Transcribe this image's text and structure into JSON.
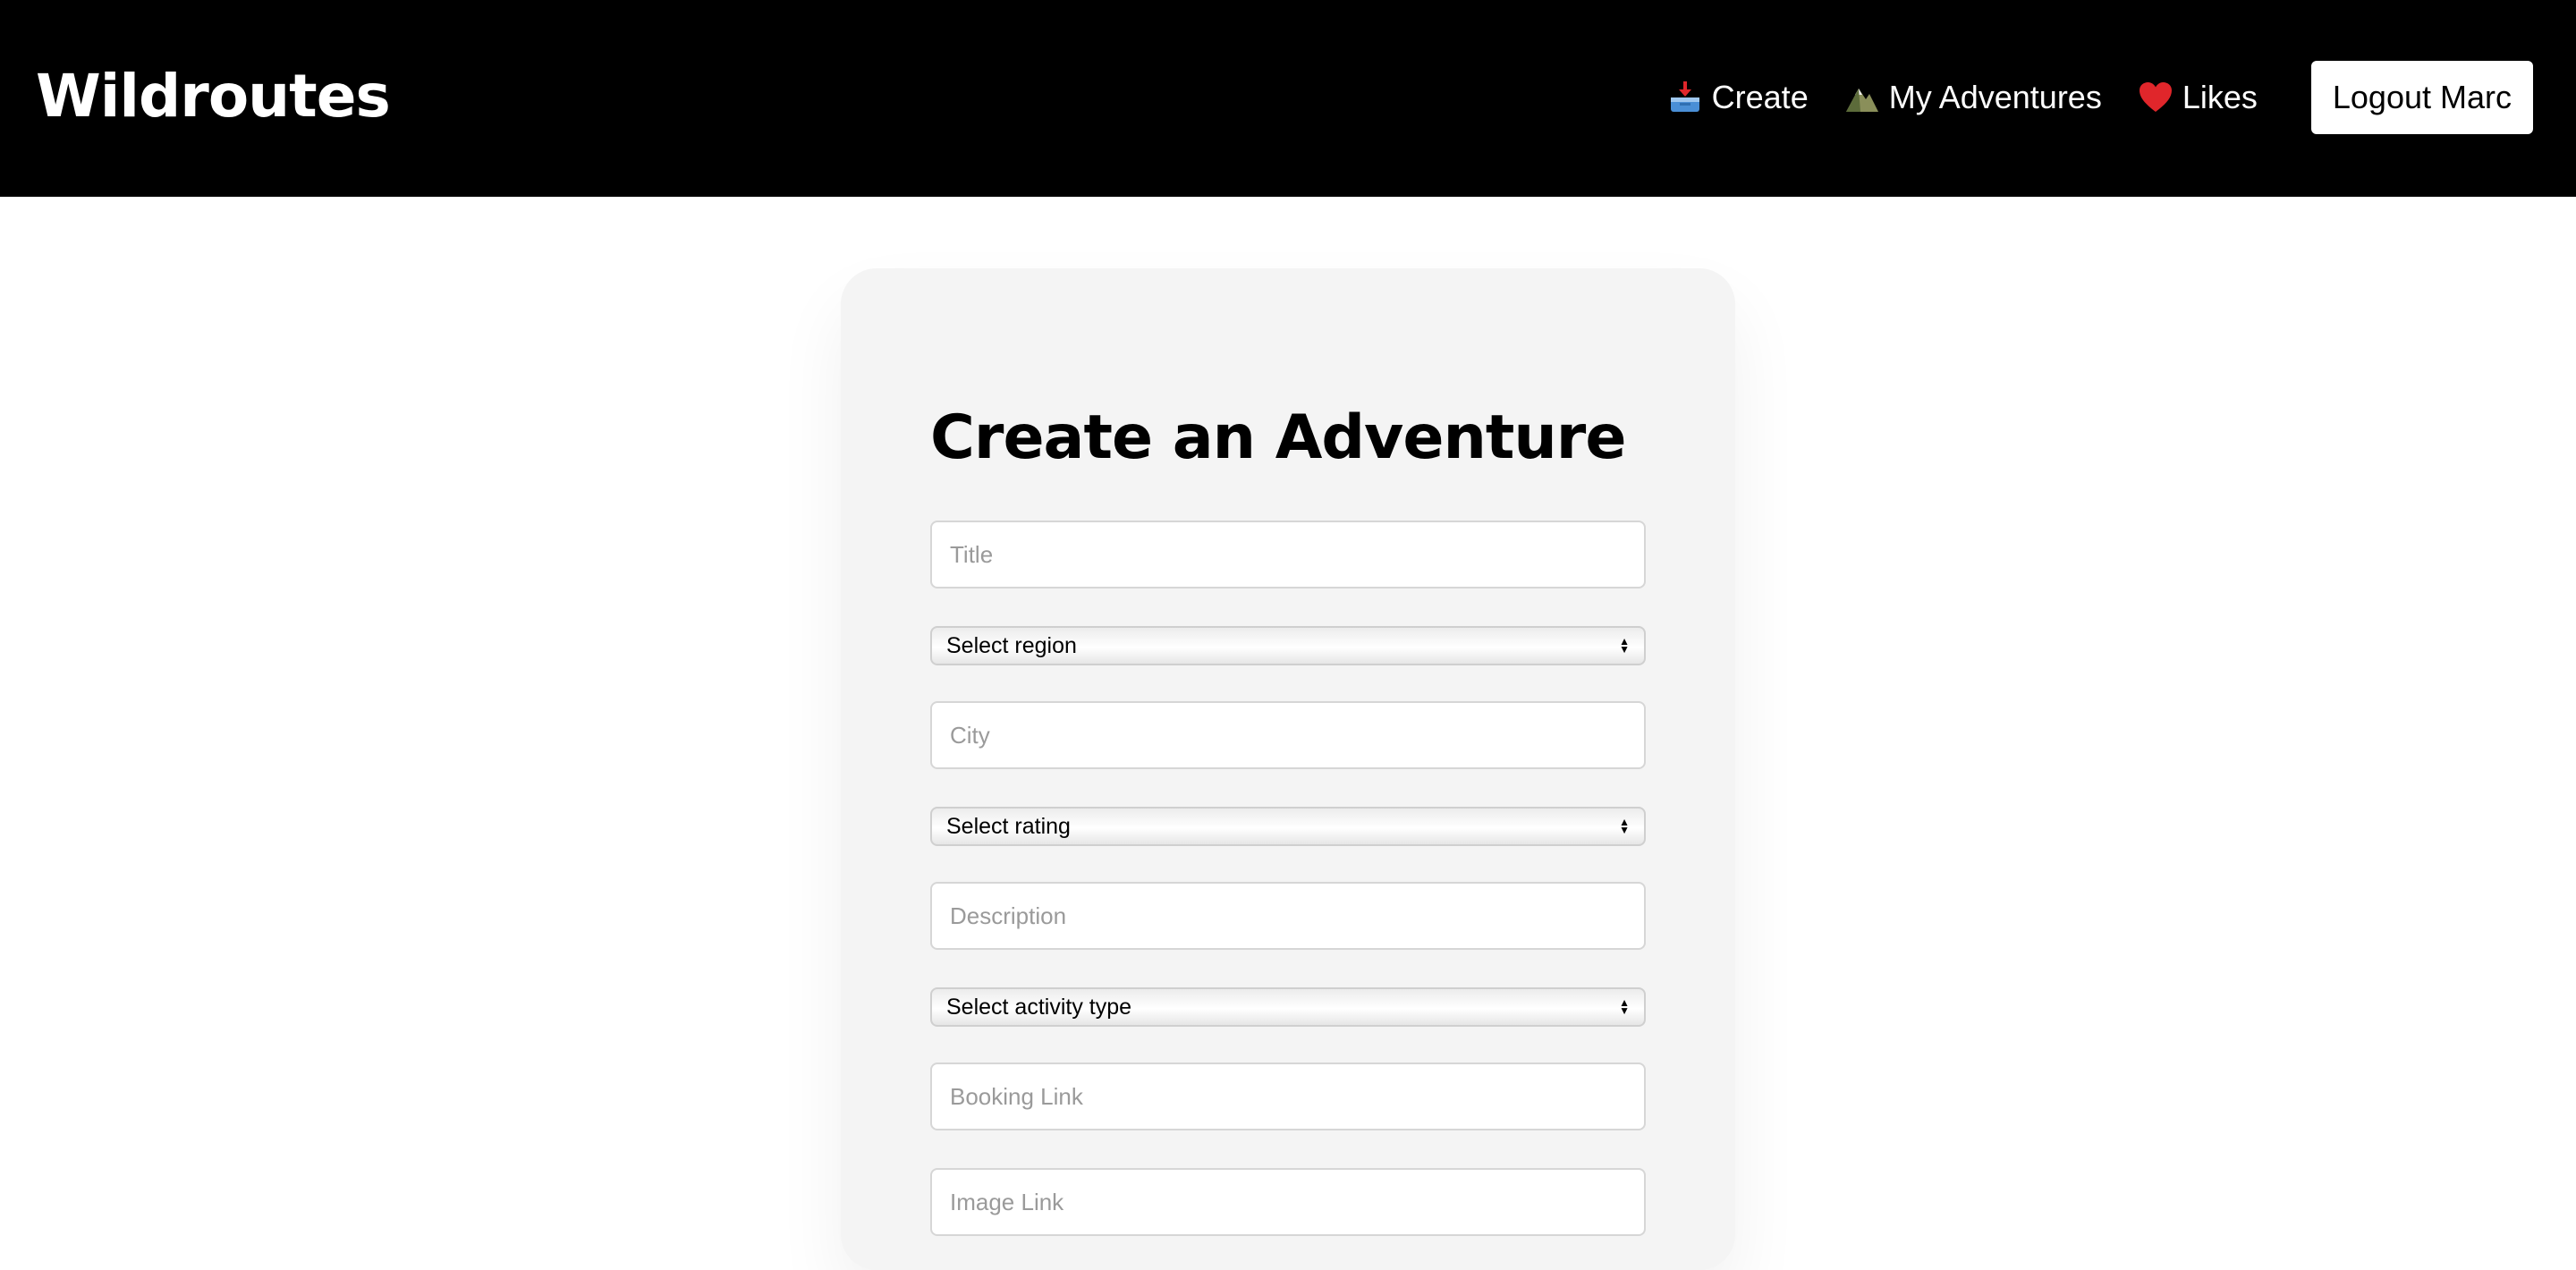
{
  "brand": "Wildroutes",
  "nav": {
    "create": {
      "icon": "inbox-tray-icon",
      "label": "Create"
    },
    "my_adventures": {
      "icon": "mountain-icon",
      "label": "My Adventures"
    },
    "likes": {
      "icon": "heart-icon",
      "label": "Likes"
    },
    "logout": "Logout Marc"
  },
  "form": {
    "title": "Create an Adventure",
    "title_placeholder": "Title",
    "region_select": "Select region",
    "city_placeholder": "City",
    "rating_select": "Select rating",
    "description_placeholder": "Description",
    "activity_select": "Select activity type",
    "booking_placeholder": "Booking Link",
    "image_placeholder": "Image Link"
  },
  "colors": {
    "navbar": "#000000",
    "card": "#f4f4f4",
    "heart": "#e0262b"
  }
}
